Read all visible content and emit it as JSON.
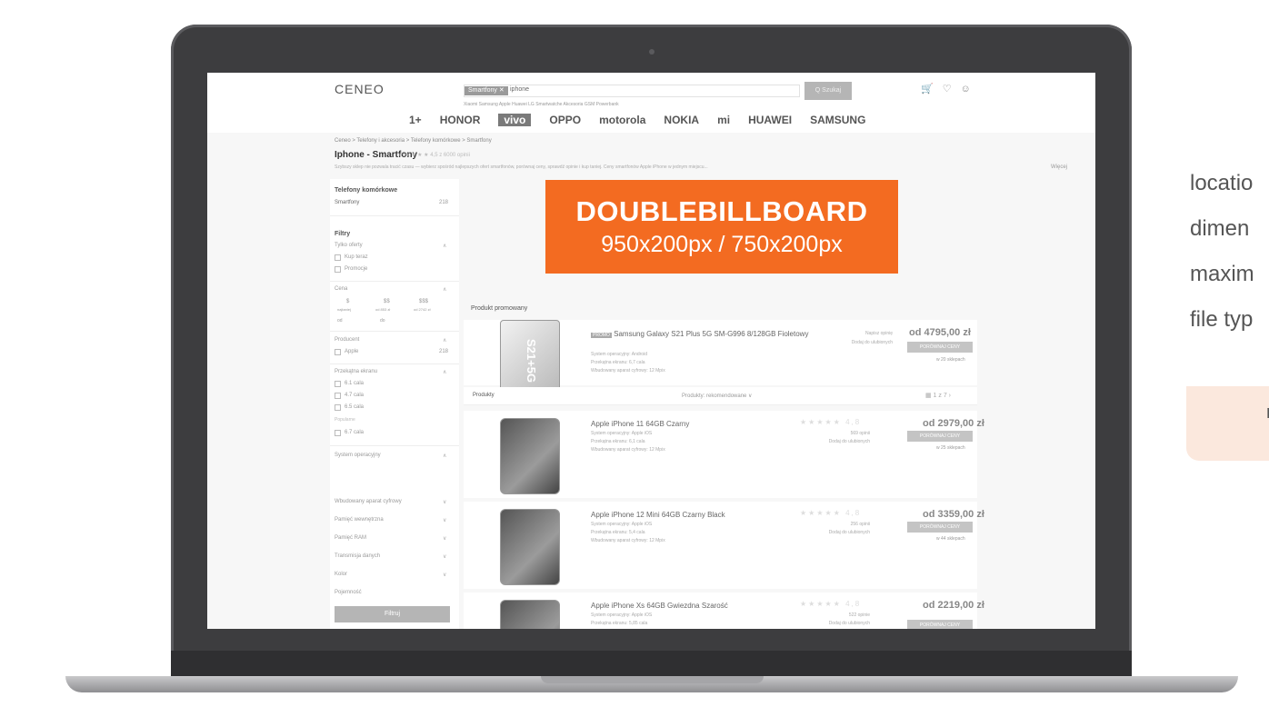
{
  "site": {
    "logo": "CENEO",
    "search_chip": "Smartfony ✕",
    "search_query": "iphone",
    "search_button": "Q  Szukaj",
    "header_icons": "🛒♡☺",
    "suggestions": "Xiaomi   Samsung   Apple   Huawei   LG   Smartwatche   Akcesoria GSM   Powerbank",
    "brands": [
      "1+",
      "HONOR",
      "vivo",
      "OPPO",
      "motorola",
      "NOKIA",
      "mi",
      "HUAWEI",
      "SAMSUNG"
    ]
  },
  "breadcrumb": "Ceneo  >  Telefony i akcesoria  >  Telefony komórkowe  >  Smartfony",
  "page_title": "Iphone - Smartfony",
  "rating_text": "★ ★ ★ ★ ★   4,5 z 6000 opinii",
  "description": "Szybszy sklep nie pozwala tracić czasu — wybierz spośród najlepszych ofert smartfonów, porównaj ceny, sprawdź opinie i kup taniej. Ceny smartfonów Apple iPhone w jednym miejscu...",
  "more_link": "Więcej",
  "sidebar": {
    "category_title": "Telefony komórkowe",
    "category_item": "Smartfony",
    "category_count": "218",
    "filters_title": "Filtry",
    "only_offers": "Tylko oferty",
    "opt_kup_teraz": "Kup teraz",
    "opt_promocje": "Promocje",
    "price_title": "Cena",
    "price_levels": [
      "$",
      "$$",
      "$$$"
    ],
    "price_subs": [
      "najtaniej",
      "od 853 zł",
      "od 2742 zł"
    ],
    "price_from": "od",
    "price_to": "do",
    "producer_title": "Producent",
    "producer_apple": "Apple",
    "producer_count": "218",
    "screen_title": "Przekątna ekranu",
    "screens": [
      "6.1 cala",
      "4.7 cala",
      "6.5 cala"
    ],
    "popular": "Popularne",
    "screen_extra": "6.7 cala",
    "os_title": "System operacyjny",
    "collapsed": [
      "Wbudowany aparat cyfrowy",
      "Pamięć wewnętrzna",
      "Pamięć RAM",
      "Transmisja danych",
      "Kolor",
      "Pojemność"
    ],
    "filter_button": "Filtruj"
  },
  "billboard": {
    "line1": "DOUBLEBILLBOARD",
    "line2": "950x200px / 750x200px"
  },
  "promo_label": "Produkt promowany",
  "promo": {
    "badge": "PROMO",
    "name": "Samsung Galaxy S21 Plus 5G SM-G996 8/128GB Fioletowy",
    "spec1": "System operacyjny: Android",
    "spec2": "Przekątna ekranu: 6,7 cala",
    "spec3": "Wbudowany aparat cyfrowy: 12 Mpix",
    "reviews": "Napisz opinię",
    "fav": "Dodaj do ulubionych",
    "price": "od 4795,00 zł",
    "compare": "PORÓWNAJ CENY",
    "shops": "w 20 sklepach",
    "phone_text": "S21+5G"
  },
  "list_bar": {
    "tab": "Produkty",
    "sort": "Produkty: rekomendowane   ∨",
    "pager": "▦     1   z 7  ›"
  },
  "products": [
    {
      "name": "Apple iPhone 11 64GB Czarny",
      "os": "System operacyjny: Apple iOS",
      "screen": "Przekątna ekranu: 6,1 cala",
      "cam": "Wbudowany aparat cyfrowy: 12 Mpix",
      "stars": "★★★★★  4,8",
      "reviews": "569 opinii",
      "fav": "Dodaj do ulubionych",
      "price": "od 2979,00 zł",
      "compare": "PORÓWNAJ CENY",
      "shops": "w 25 sklepach"
    },
    {
      "name": "Apple iPhone 12 Mini 64GB Czarny Black",
      "os": "System operacyjny: Apple iOS",
      "screen": "Przekątna ekranu: 5,4 cala",
      "cam": "Wbudowany aparat cyfrowy: 12 Mpix",
      "stars": "★★★★★  4,8",
      "reviews": "256 opinii",
      "fav": "Dodaj do ulubionych",
      "price": "od 3359,00 zł",
      "compare": "PORÓWNAJ CENY",
      "shops": "w 44 sklepach"
    },
    {
      "name": "Apple iPhone Xs 64GB Gwiezdna Szarość",
      "os": "System operacyjny: Apple iOS",
      "screen": "Przekątna ekranu: 5,85 cala",
      "cam": "",
      "stars": "★★★★★  4,8",
      "reviews": "522 opinie",
      "fav": "Dodaj do ulubionych",
      "price": "od 2219,00 zł",
      "compare": "PORÓWNAJ CENY",
      "shops": ""
    }
  ],
  "right_text": [
    "locatio",
    "dimen",
    "maxim",
    "file typ"
  ],
  "right_box": "r",
  "colors": {
    "billboard": "#f36b21",
    "laptop": "#3d3d3f",
    "right_box": "#fbe8dd"
  }
}
